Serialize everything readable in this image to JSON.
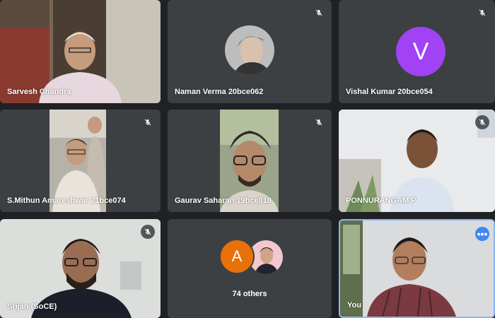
{
  "colors": {
    "tile_bg": "#3c4043",
    "page_bg": "#202124",
    "avatar_purple": "#a142f4",
    "avatar_orange": "#e8710a",
    "active_border": "#8ab4f8"
  },
  "participants": [
    {
      "name": "Sarvesh Chandra",
      "muted": false,
      "view": "video"
    },
    {
      "name": "Naman Verma 20bce062",
      "muted": true,
      "view": "photo-avatar"
    },
    {
      "name": "Vishal Kumar 20bce054",
      "muted": true,
      "view": "letter-avatar",
      "avatar_letter": "V"
    },
    {
      "name": "S.Mithun Amareshwar 21bce074",
      "muted": true,
      "view": "video"
    },
    {
      "name": "Gaurav Saharan 19bce018",
      "muted": true,
      "view": "video"
    },
    {
      "name": "PONNURANGAM P",
      "muted": true,
      "view": "video"
    },
    {
      "name": "Srijan (SoCE)",
      "muted": true,
      "view": "video"
    },
    {
      "name": "You",
      "muted": false,
      "view": "video",
      "more_options_icon": "more-horiz-icon"
    }
  ],
  "others": {
    "label": "74 others",
    "avatar_letter": "A"
  },
  "icons": {
    "mic_off": "mic-off-icon",
    "more": "more-options-icon"
  }
}
